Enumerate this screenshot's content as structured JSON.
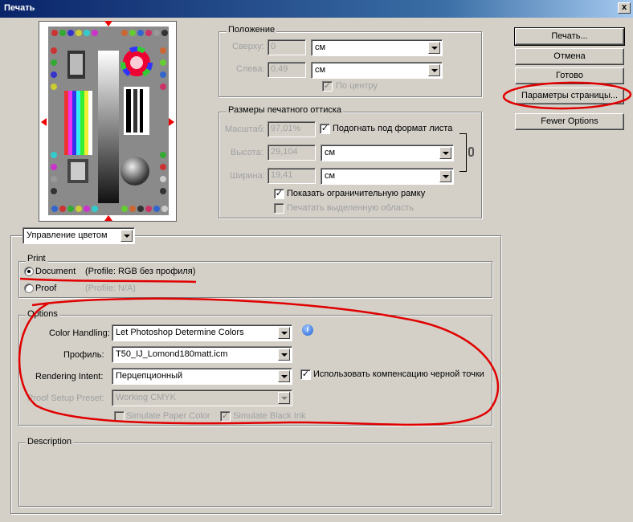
{
  "window": {
    "title": "Печать",
    "close_label": "x"
  },
  "position": {
    "title": "Положение",
    "top_label": "Сверху:",
    "top_value": "0",
    "top_unit": "см",
    "left_label": "Слева:",
    "left_value": "0,49",
    "left_unit": "см",
    "center_label": "По центру",
    "center_checked": true
  },
  "print_size": {
    "title": "Размеры печатного оттиска",
    "scale_label": "Масштаб:",
    "scale_value": "97,01%",
    "fit_label": "Подогнать под формат листа",
    "fit_checked": true,
    "height_label": "Высота:",
    "height_value": "29,104",
    "height_unit": "см",
    "width_label": "Ширина:",
    "width_value": "19,41",
    "width_unit": "см",
    "bbox_label": "Показать ограничительную рамку",
    "bbox_checked": true,
    "print_sel_label": "Печатать выделенную область",
    "print_sel_checked": false
  },
  "buttons": {
    "print": "Печать...",
    "cancel": "Отмена",
    "done": "Готово",
    "page_setup": "Параметры страницы...",
    "fewer_options": "Fewer Options"
  },
  "section_select": {
    "value": "Управление цветом"
  },
  "print_group": {
    "title": "Print",
    "document_label": "Document",
    "document_profile": "(Profile: RGB без профиля)",
    "proof_label": "Proof",
    "proof_profile": "(Profile: N/A)"
  },
  "options": {
    "title": "Options",
    "color_handling_label": "Color Handling:",
    "color_handling_value": "Let Photoshop Determine Colors",
    "profile_label": "Профиль:",
    "profile_value": "T50_IJ_Lomond180matt.icm",
    "intent_label": "Rendering Intent:",
    "intent_value": "Перцепционный",
    "bpc_label": "Использовать компенсацию черной точки",
    "bpc_checked": true,
    "proof_preset_label": "Proof Setup Preset:",
    "proof_preset_value": "Working CMYK",
    "sim_paper_label": "Simulate Paper Color",
    "sim_paper_checked": false,
    "sim_black_label": "Simulate Black Ink",
    "sim_black_checked": true
  },
  "description": {
    "title": "Description"
  },
  "colors": {
    "annotation": "#e00000",
    "dialog_bg": "#d4d0c8"
  }
}
